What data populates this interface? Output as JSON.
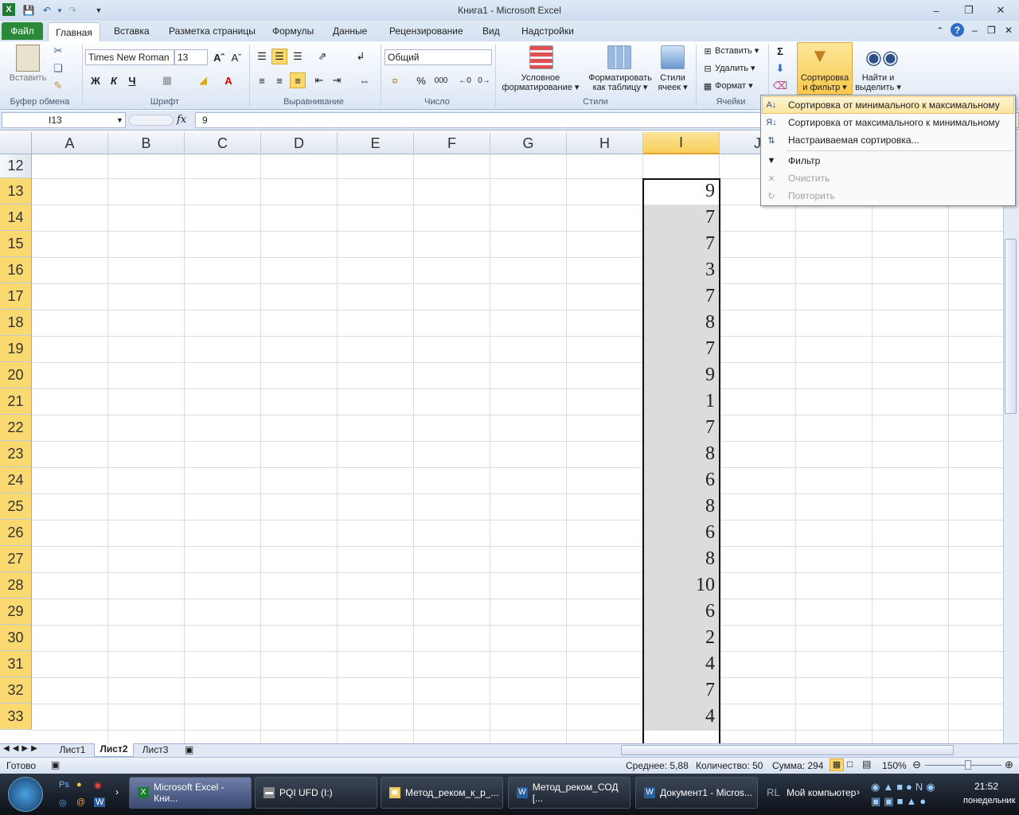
{
  "window": {
    "title": "Книга1  -  Microsoft Excel"
  },
  "tabs": {
    "file": "Файл",
    "home": "Главная",
    "insert": "Вставка",
    "page_layout": "Разметка страницы",
    "formulas": "Формулы",
    "data": "Данные",
    "review": "Рецензирование",
    "view": "Вид",
    "addins": "Надстройки"
  },
  "ribbon": {
    "clipboard": {
      "paste": "Вставить",
      "label": "Буфер обмена"
    },
    "font": {
      "name": "Times New Roman",
      "size": "13",
      "bold": "Ж",
      "italic": "К",
      "underline": "Ч",
      "label": "Шрифт"
    },
    "alignment": {
      "label": "Выравнивание"
    },
    "number": {
      "format": "Общий",
      "label": "Число",
      "percent": "%",
      "thousands": "000"
    },
    "styles": {
      "conditional": "Условное",
      "conditional2": "форматирование",
      "as_table": "Форматировать",
      "as_table2": "как таблицу",
      "cell_styles": "Стили",
      "cell_styles2": "ячеек",
      "label": "Стили"
    },
    "cells": {
      "insert": "Вставить",
      "delete": "Удалить",
      "format": "Формат",
      "label": "Ячейки"
    },
    "editing": {
      "sort_filter": "Сортировка",
      "sort_filter2": "и фильтр",
      "find": "Найти и",
      "find2": "выделить"
    }
  },
  "formula_bar": {
    "name_box": "I13",
    "fx": "fx",
    "value": "9"
  },
  "columns": [
    "A",
    "B",
    "C",
    "D",
    "E",
    "F",
    "G",
    "H",
    "I",
    "J"
  ],
  "rows": [
    "12",
    "13",
    "14",
    "15",
    "16",
    "17",
    "18",
    "19",
    "20",
    "21",
    "22",
    "23",
    "24",
    "25",
    "26",
    "27",
    "28",
    "29",
    "30",
    "31",
    "32",
    "33"
  ],
  "column_i_values": [
    "",
    "9",
    "7",
    "7",
    "3",
    "7",
    "8",
    "7",
    "9",
    "1",
    "7",
    "8",
    "6",
    "8",
    "6",
    "8",
    "10",
    "6",
    "2",
    "4",
    "7",
    "4"
  ],
  "dropdown": {
    "sort_asc": "Сортировка от минимального к максимальному",
    "sort_desc": "Сортировка от максимального к минимальному",
    "custom": "Настраиваемая сортировка...",
    "filter": "Фильтр",
    "clear": "Очистить",
    "reapply": "Повторить"
  },
  "sheets": [
    "Лист1",
    "Лист2",
    "Лист3"
  ],
  "status": {
    "ready": "Готово",
    "average": "Среднее: 5,88",
    "count": "Количество: 50",
    "sum": "Сумма: 294",
    "zoom": "150%"
  },
  "taskbar": {
    "items": [
      "Microsoft Excel - Кни...",
      "PQI UFD (I:)",
      "Метод_реком_к_р_...",
      "Метод_реком_СОД [...",
      "Документ1 - Micros..."
    ],
    "my_computer": "Мой компьютер",
    "lang": "RL",
    "time": "21:52",
    "day": "понедельник"
  },
  "colors": {
    "accent": "#2a8a3a",
    "selected_header": "#f9d970",
    "selection_fill": "#dcdcdc"
  }
}
